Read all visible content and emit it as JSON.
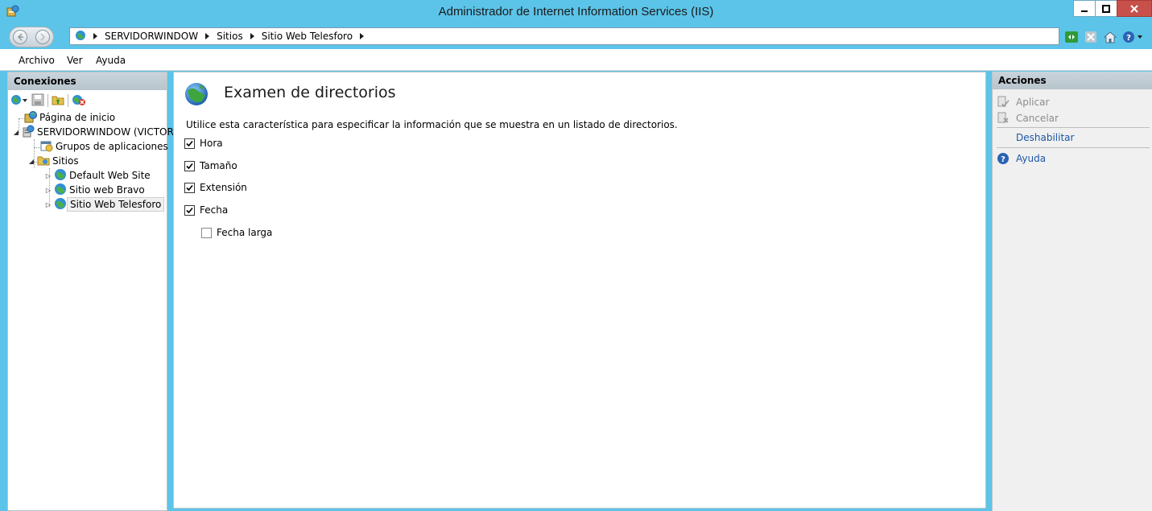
{
  "window": {
    "title": "Administrador de Internet Information Services (IIS)",
    "minimize_label": "_",
    "maximize_label": "□",
    "close_label": "X"
  },
  "address": {
    "crumbs": [
      "SERVIDORWINDOW",
      "Sitios",
      "Sitio Web Telesforo"
    ]
  },
  "menu": {
    "items": [
      "Archivo",
      "Ver",
      "Ayuda"
    ]
  },
  "connections": {
    "header": "Conexiones",
    "tree": {
      "home": "Página de inicio",
      "server": "SERVIDORWINDOW (VICTORW",
      "app_pools": "Grupos de aplicaciones",
      "sites": "Sitios",
      "site_items": [
        "Default Web Site",
        "Sitio web Bravo",
        "Sitio Web Telesforo"
      ]
    }
  },
  "main": {
    "title": "Examen de directorios",
    "description": "Utilice esta característica para especificar la información que se muestra en un listado de directorios.",
    "options": [
      {
        "label": "Hora",
        "checked": true
      },
      {
        "label": "Tamaño",
        "checked": true
      },
      {
        "label": "Extensión",
        "checked": true
      },
      {
        "label": "Fecha",
        "checked": true
      },
      {
        "label": "Fecha larga",
        "checked": false
      }
    ]
  },
  "actions": {
    "header": "Acciones",
    "apply": "Aplicar",
    "cancel": "Cancelar",
    "disable": "Deshabilitar",
    "help": "Ayuda"
  },
  "colors": {
    "titlebar": "#5cc4e8",
    "link": "#1c56a8",
    "close": "#c7504a"
  }
}
